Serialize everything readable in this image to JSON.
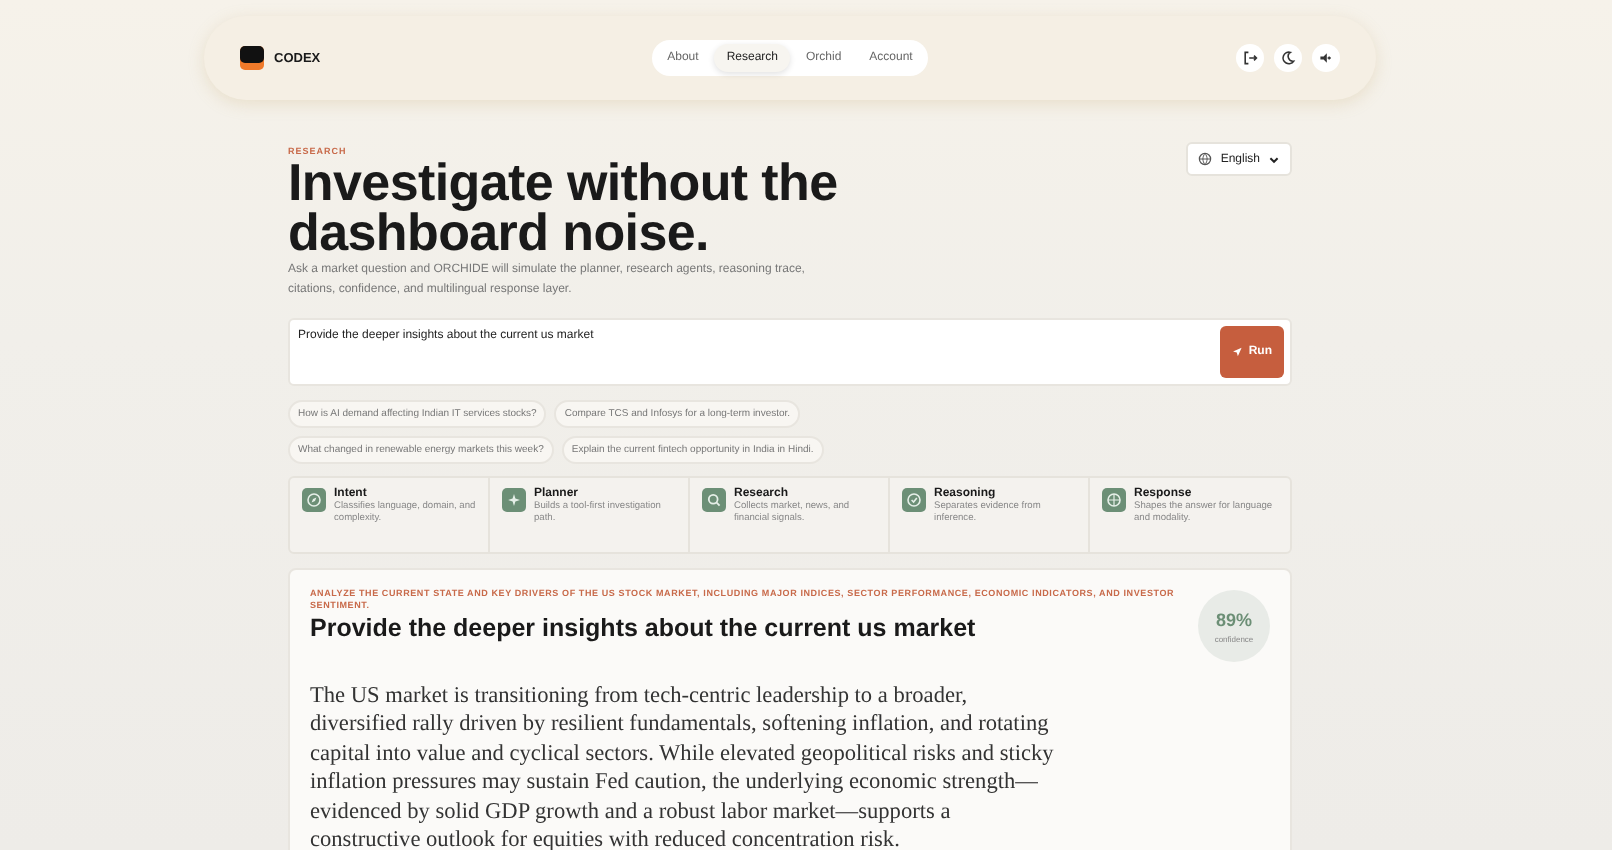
{
  "brand": {
    "name": "CODEX"
  },
  "nav": [
    {
      "label": "About",
      "selected": false
    },
    {
      "label": "Research",
      "selected": true
    },
    {
      "label": "Orchid",
      "selected": false
    },
    {
      "label": "Account",
      "selected": false
    }
  ],
  "header_actions": [
    {
      "kind": "logout"
    },
    {
      "kind": "theme"
    },
    {
      "kind": "sound"
    }
  ],
  "eyebrow": "RESEARCH",
  "title": "Investigate without the dashboard noise.",
  "subtitle": "Ask a market question and ORCHIDE will simulate the planner, research agents, reasoning trace, citations, confidence, and multilingual response layer.",
  "language": {
    "value": "English"
  },
  "query": {
    "value": "Provide the deeper insights about the current us market",
    "button": "Run"
  },
  "suggestions": [
    "How is AI demand affecting Indian IT services stocks?",
    "Compare TCS and Infosys for a long-term investor.",
    "What changed in renewable energy markets this week?",
    "Explain the current fintech opportunity in India in Hindi."
  ],
  "steps": [
    {
      "kind": "intent",
      "title": "Intent",
      "description": "Classifies language, domain, and complexity."
    },
    {
      "kind": "planner",
      "title": "Planner",
      "description": "Builds a tool-first investigation path."
    },
    {
      "kind": "research",
      "title": "Research",
      "description": "Collects market, news, and financial signals."
    },
    {
      "kind": "reasoning",
      "title": "Reasoning",
      "description": "Separates evidence from inference."
    },
    {
      "kind": "response",
      "title": "Response",
      "description": "Shapes the answer for language and modality."
    }
  ],
  "result": {
    "eyebrow": "ANALYZE THE CURRENT STATE AND KEY DRIVERS OF THE US STOCK MARKET, INCLUDING MAJOR INDICES, SECTOR PERFORMANCE, ECONOMIC INDICATORS, AND INVESTOR SENTIMENT.",
    "title": "Provide the deeper insights about the current us market",
    "confidence": "89%",
    "confidence_label": "confidence",
    "body": "The US market is transitioning from tech-centric leadership to a broader, diversified rally driven by resilient fundamentals, softening inflation, and rotating capital into value and cyclical sectors. While elevated geopolitical risks and sticky inflation pressures may sustain Fed caution, the underlying economic strength—evidenced by solid GDP growth and a robust labor market—supports a constructive outlook for equities with reduced concentration risk."
  }
}
